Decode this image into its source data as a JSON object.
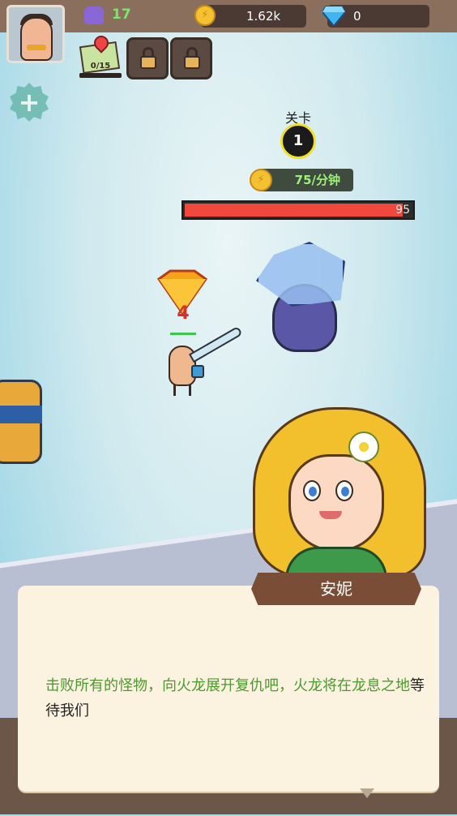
{
  "hud": {
    "power": "17",
    "gold": "1.62k",
    "gems": "0",
    "map_progress": "0/15"
  },
  "level": {
    "label": "关卡",
    "number": "1"
  },
  "income": {
    "rate": "75/分钟"
  },
  "enemy": {
    "hp": "95",
    "hp_fraction": 0.96
  },
  "hero": {
    "level": "4"
  },
  "dialog": {
    "speaker": "安妮",
    "text_highlight_1": "击败所有的怪物，向火龙展开复仇吧，火龙将在",
    "text_highlight_2": "龙息之地",
    "text_tail": "等待我们"
  },
  "colors": {
    "accent_green": "#4c9a2e",
    "hp_red": "#f0483c",
    "name_tag": "#7a4e36",
    "level_ring": "#f2e02a"
  }
}
